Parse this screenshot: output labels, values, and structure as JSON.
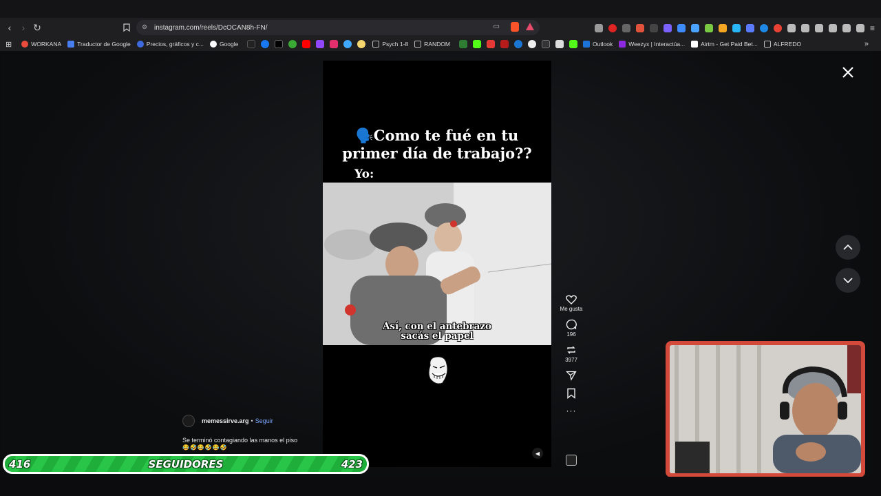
{
  "browser": {
    "url": "instagram.com/reels/DcOCAN8h-FN/",
    "bookmarks": [
      {
        "label": "WORKANA",
        "color": "#e94b3c"
      },
      {
        "label": "Traductor de Google",
        "color": "#4a7df0"
      },
      {
        "label": "Precios, gráficos y c...",
        "color": "#3e6ae0"
      },
      {
        "label": "Google",
        "color": "#ffffff"
      },
      {
        "label": "Psych 1-8",
        "color": "#888888"
      },
      {
        "label": "RANDOM",
        "color": "#888888"
      },
      {
        "label": "Outlook",
        "color": "#1e73d8"
      },
      {
        "label": "Weezyx | Interactúa...",
        "color": "#8b2be0"
      },
      {
        "label": "Airtm - Get Paid Bet...",
        "color": "#ffffff"
      },
      {
        "label": "ALFREDO",
        "color": "#888888"
      }
    ]
  },
  "reel": {
    "title_line1": "🗣️Como te fué en tu",
    "title_line2": "primer día de trabajo??",
    "yo": "Yo:",
    "caption_line1": "Así, con el antebrazo",
    "caption_line2": "sacás el papel"
  },
  "actions": {
    "like_label": "Me gusta",
    "comments": "196",
    "reposts": "3977"
  },
  "post": {
    "author": "memessirve.arg",
    "separator": "•",
    "follow": "Seguir",
    "description": "Se terminó contagiando las manos el piso",
    "emojis": "😂🤣😂🤣😂🤣"
  },
  "followers_overlay": {
    "left_count": "416",
    "label": "SEGUIDORES",
    "right_count": "423"
  }
}
